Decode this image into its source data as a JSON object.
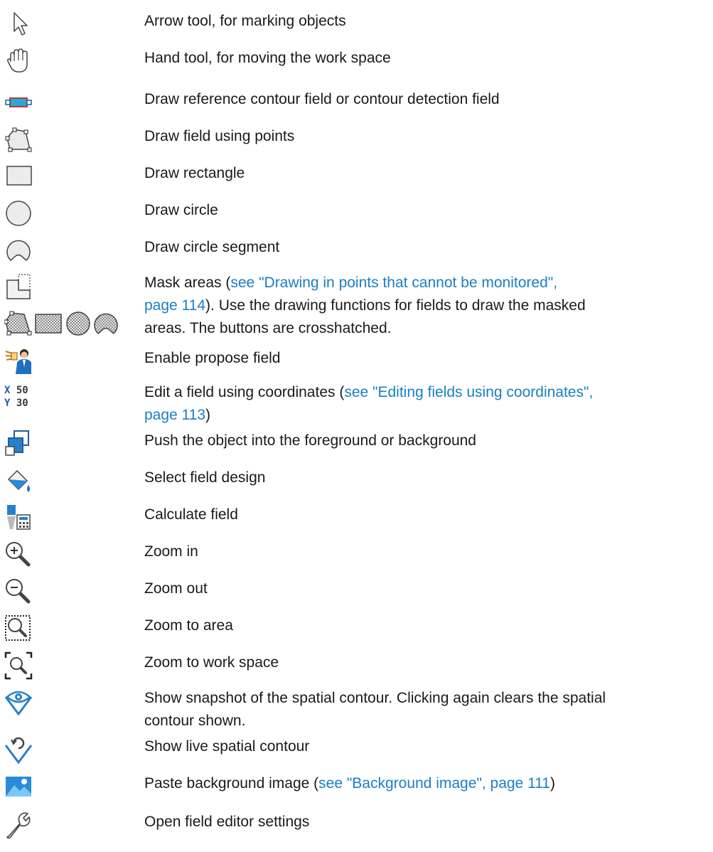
{
  "rows": [
    {
      "icon": "arrow-cursor-icon",
      "text": "Arrow tool, for marking objects"
    },
    {
      "icon": "hand-icon",
      "text": "Hand tool, for moving the work space"
    },
    {
      "icon": "reference-contour-icon",
      "text": "Draw reference contour field or contour detection field"
    },
    {
      "icon": "polygon-points-icon",
      "text": "Draw field using points"
    },
    {
      "icon": "rectangle-icon",
      "text": "Draw rectangle"
    },
    {
      "icon": "circle-icon",
      "text": "Draw circle"
    },
    {
      "icon": "circle-segment-icon",
      "text": "Draw circle segment"
    },
    {
      "icon": "mask-areas-icon",
      "parts": [
        {
          "text": "Mask areas ("
        },
        {
          "text": "see \"Drawing in points that cannot be monitored\",",
          "link": true
        },
        {
          "text": "page 114",
          "link": true
        },
        {
          "text": "). Use the drawing functions for fields to draw the masked"
        },
        {
          "text": "areas. The buttons are crosshatched."
        }
      ],
      "extra_icons": [
        "mask-polygon-icon",
        "mask-rectangle-icon",
        "mask-circle-icon",
        "mask-segment-icon"
      ]
    },
    {
      "icon": "propose-field-icon",
      "text": "Enable propose field"
    },
    {
      "icon": "coordinates-icon",
      "icon_text": {
        "x": "X",
        "x_val": "50",
        "y": "Y",
        "y_val": "30"
      },
      "parts": [
        {
          "text": "Edit a field using coordinates ("
        },
        {
          "text": "see \"Editing fields using coordinates\",",
          "link": true
        },
        {
          "text": "page 113",
          "link": true
        },
        {
          "text": ")"
        }
      ]
    },
    {
      "icon": "layer-order-icon",
      "text": "Push the object into the foreground or background"
    },
    {
      "icon": "paint-bucket-icon",
      "text": "Select field design"
    },
    {
      "icon": "calculate-field-icon",
      "text": "Calculate field"
    },
    {
      "icon": "zoom-in-icon",
      "text": "Zoom in"
    },
    {
      "icon": "zoom-out-icon",
      "text": "Zoom out"
    },
    {
      "icon": "zoom-area-icon",
      "text": "Zoom to area"
    },
    {
      "icon": "zoom-workspace-icon",
      "text": "Zoom to work space"
    },
    {
      "icon": "snapshot-eye-icon",
      "text": "Show snapshot of the spatial contour. Clicking again clears the spatial",
      "text2": "contour shown."
    },
    {
      "icon": "live-contour-icon",
      "text": "Show live spatial contour"
    },
    {
      "icon": "background-image-icon",
      "parts": [
        {
          "text": "Paste background image ("
        },
        {
          "text": "see \"Background image\", page 111",
          "link": true
        },
        {
          "text": ")"
        }
      ]
    },
    {
      "icon": "wrench-icon",
      "text": "Open field editor settings"
    }
  ],
  "colors": {
    "link": "#1a7fc1",
    "text": "#1a1a1a",
    "icon_blue": "#2a7fc9",
    "icon_red": "#c0392b",
    "icon_gray": "#6e6e6e"
  }
}
